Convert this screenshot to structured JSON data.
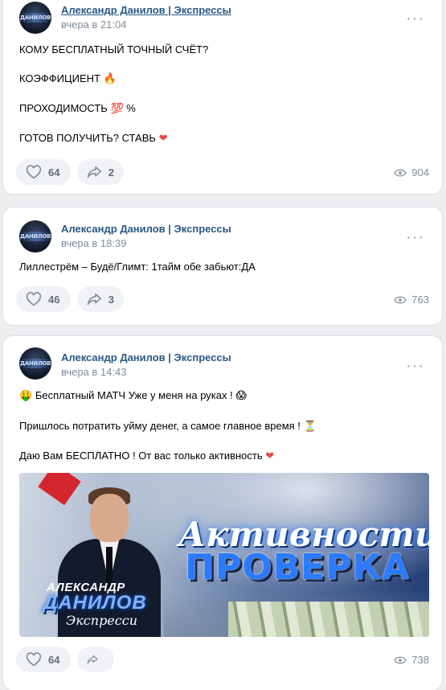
{
  "posts": [
    {
      "author": "Александр Данилов | Экспрессы",
      "time": "вчера в 21:04",
      "lines": [
        "КОМУ БЕСПЛАТНЫЙ ТОЧНЫЙ СЧЁТ?",
        "КОЭФФИЦИЕНТ",
        "ПРОХОДИМОСТЬ",
        "%",
        "ГОТОВ ПОЛУЧИТЬ? СТАВЬ"
      ],
      "likes": "64",
      "shares": "2",
      "views": "904"
    },
    {
      "author": "Александр Данилов | Экспрессы",
      "time": "вчера в 18:39",
      "lines": [
        "Лиллестрём – Будё/Глимт: 1тайм обе забьют:ДА"
      ],
      "likes": "46",
      "shares": "3",
      "views": "763"
    },
    {
      "author": "Александр Данилов | Экспрессы",
      "time": "вчера в 14:43",
      "lines": [
        "Бесплатный МАТЧ Уже у меня на руках !",
        "Пришлось потратить уйму денег, а самое главное время !",
        "Даю Вам БЕСПЛАТНО ! От вас только активность"
      ],
      "likes": "64",
      "shares": "",
      "views": "738",
      "banner": {
        "name_top": "АЛЕКСАНДР",
        "name_main": "ДАНИЛОВ",
        "name_sub": "Экспресси",
        "title_script": "Активности",
        "title_main": "ПРОВЕРКА"
      }
    }
  ],
  "avatar_text": "ДАНИЛОВ",
  "emojis": {
    "fire": "🔥",
    "hundred": "💯",
    "heart": "❤",
    "money_face": "🤑",
    "scream": "😱",
    "hourglass": "⏳"
  },
  "colors": {
    "link": "#2a5885",
    "muted": "#818c99",
    "button_bg": "#f0f2f5",
    "heart": "#e64646"
  }
}
